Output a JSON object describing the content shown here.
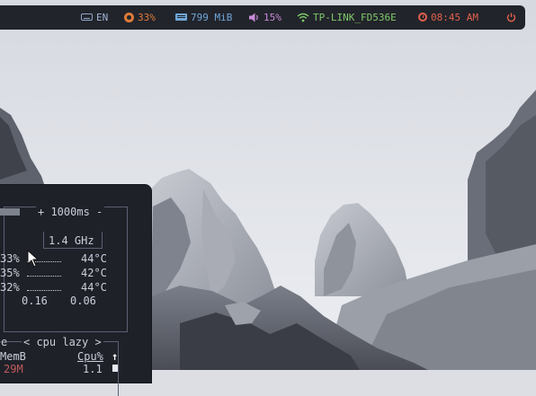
{
  "topbar": {
    "keyboard_layout": "EN",
    "cpu_usage": "33%",
    "memory_used": "799 MiB",
    "volume": "15%",
    "wifi_ssid": "TP-LINK_FD536E",
    "time": "08:45 AM"
  },
  "btop": {
    "update_interval": "+ 1000ms -",
    "cpu_freq": "1.4 GHz",
    "cores": [
      {
        "usage": "33%",
        "temp": "44°C"
      },
      {
        "usage": "35%",
        "temp": "42°C"
      },
      {
        "usage": "32%",
        "temp": "44°C"
      }
    ],
    "load_avg": [
      "0.16",
      "0.06"
    ],
    "proc_header_left": "e",
    "proc_sort": "< cpu lazy >",
    "col_mem": "MemB",
    "col_cpu": "Cpu%",
    "sort_arrow": "↑",
    "first_row_mem": "29M",
    "first_row_cpu": "1.1"
  },
  "colors": {
    "bar_bg": "#22242b",
    "cpu": "#e07a3a",
    "memory": "#6fa7d9",
    "volume": "#c98bd8",
    "wifi": "#7fc96b",
    "clock": "#e0614b",
    "power": "#e0614b",
    "terminal_bg": "#1f2129"
  },
  "icons": [
    "keyboard-icon",
    "cpu-icon",
    "memory-icon",
    "volume-icon",
    "wifi-icon",
    "clock-icon",
    "power-icon",
    "mouse-cursor"
  ]
}
